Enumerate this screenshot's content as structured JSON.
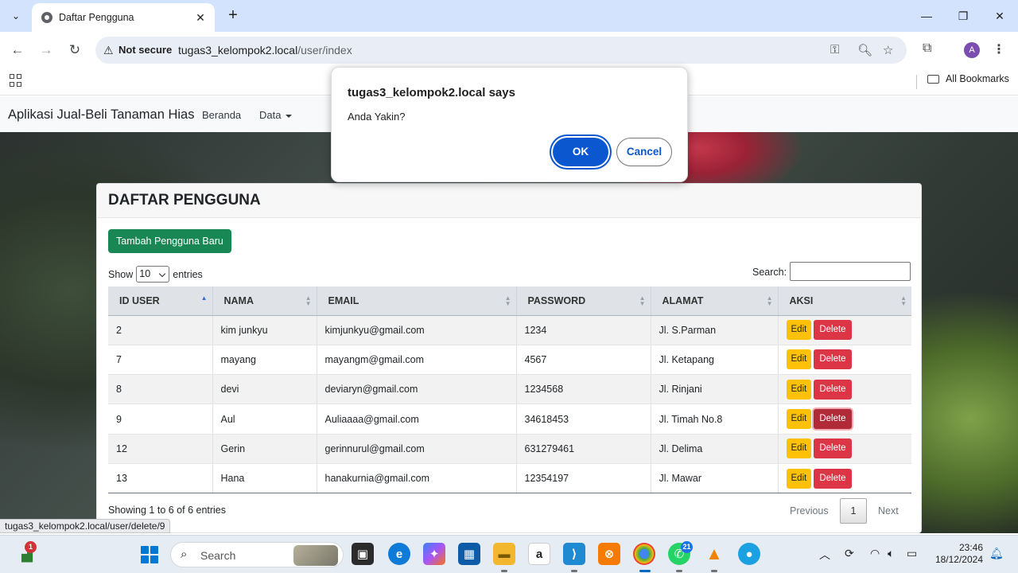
{
  "browser": {
    "tab_title": "Daftar Pengguna",
    "tab_close": "✕",
    "new_tab": "+",
    "security_label": "Not secure",
    "url_host": "tugas3_kelompok2.local",
    "url_path": "/user/index",
    "bookmarks_label": "All Bookmarks",
    "profile_initial": "A"
  },
  "site": {
    "brand": "Aplikasi Jual-Beli Tanaman Hias",
    "nav": {
      "home": "Beranda",
      "data": "Data"
    }
  },
  "card": {
    "title": "DAFTAR PENGGUNA",
    "add_button": "Tambah Pengguna Baru",
    "show_label": "Show",
    "entries_label": "entries",
    "page_size": "10",
    "search_label": "Search:",
    "info": "Showing 1 to 6 of 6 entries",
    "pager": {
      "previous": "Previous",
      "page": "1",
      "next": "Next"
    }
  },
  "table": {
    "columns": [
      "ID USER",
      "NAMA",
      "EMAIL",
      "PASSWORD",
      "ALAMAT",
      "AKSI"
    ],
    "edit_label": "Edit",
    "delete_label": "Delete",
    "rows": [
      {
        "id": "2",
        "nama": "kim junkyu",
        "email": "kimjunkyu@gmail.com",
        "password": "1234",
        "alamat": "Jl. S.Parman"
      },
      {
        "id": "7",
        "nama": "mayang",
        "email": "mayangm@gmail.com",
        "password": "4567",
        "alamat": "Jl. Ketapang"
      },
      {
        "id": "8",
        "nama": "devi",
        "email": "deviaryn@gmail.com",
        "password": "1234568",
        "alamat": "Jl. Rinjani"
      },
      {
        "id": "9",
        "nama": "Aul",
        "email": "Auliaaaa@gmail.com",
        "password": "34618453",
        "alamat": "Jl. Timah No.8"
      },
      {
        "id": "12",
        "nama": "Gerin",
        "email": "gerinnurul@gmail.com",
        "password": "631279461",
        "alamat": "Jl. Delima"
      },
      {
        "id": "13",
        "nama": "Hana",
        "email": "hanakurnia@gmail.com",
        "password": "12354197",
        "alamat": "Jl. Mawar"
      }
    ]
  },
  "dialog": {
    "title": "tugas3_kelompok2.local says",
    "message": "Anda Yakin?",
    "ok": "OK",
    "cancel": "Cancel"
  },
  "status_url": "tugas3_kelompok2.local/user/delete/9",
  "taskbar": {
    "search_placeholder": "Search",
    "time": "23:46",
    "date": "18/12/2024",
    "badge_left": "1",
    "badge_whatsapp": "21"
  },
  "colors": {
    "primary_blue": "#0b57d0",
    "success": "#198754",
    "warning": "#ffc107",
    "danger": "#dc3545",
    "tabstrip": "#d3e3fd"
  }
}
